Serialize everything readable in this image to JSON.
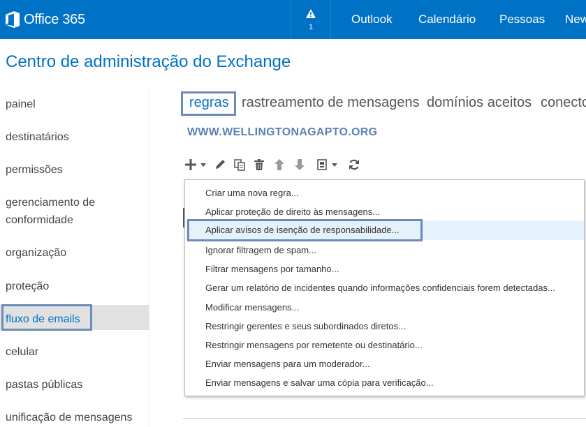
{
  "topbar": {
    "logo_text": "Office 365",
    "alert_count": "1",
    "nav": [
      "Outlook",
      "Calendário",
      "Pessoas",
      "New"
    ]
  },
  "page_title": "Centro de administração do Exchange",
  "sidebar": {
    "items": [
      {
        "label": "painel"
      },
      {
        "label": "destinatários"
      },
      {
        "label": "permissões"
      },
      {
        "label": "gerenciamento de"
      },
      {
        "label": "conformidade"
      },
      {
        "label": "organização"
      },
      {
        "label": "proteção"
      },
      {
        "label": "fluxo de emails"
      },
      {
        "label": "celular"
      },
      {
        "label": "pastas públicas"
      },
      {
        "label": "unificação de mensagens"
      }
    ],
    "selected": "fluxo de emails"
  },
  "tabs": [
    "regras",
    "rastreamento de mensagens",
    "domínios aceitos",
    "conectores"
  ],
  "watermark": "WWW.WELLINGTONAGAPTO.ORG",
  "toolbar": {
    "icons": [
      "add-icon",
      "dropdown-caret-icon",
      "edit-icon",
      "copy-icon",
      "delete-icon",
      "move-up-icon",
      "move-down-icon",
      "report-icon",
      "refresh-icon"
    ]
  },
  "menu": {
    "items": [
      "Criar uma nova regra...",
      "Aplicar proteção de direito às mensagens...",
      "Aplicar avisos de isenção de responsabilidade...",
      "Ignorar filtragem de spam...",
      "Filtrar mensagens por tamanho...",
      "Gerar um relatório de incidentes quando informações confidenciais forem detectadas...",
      "Modificar mensagens...",
      "Restringir gerentes e seus subordinados diretos...",
      "Restringir mensagens por remetente ou destinatário...",
      "Enviar mensagens para um moderador...",
      "Enviar mensagens e salvar uma cópia para verificação..."
    ],
    "highlighted_index": 2
  },
  "colors": {
    "brand": "#0072c6",
    "highlight_border": "#6b8bb8",
    "menu_hover": "#e5f1fb",
    "nav_selected": "#e1e1e1"
  }
}
